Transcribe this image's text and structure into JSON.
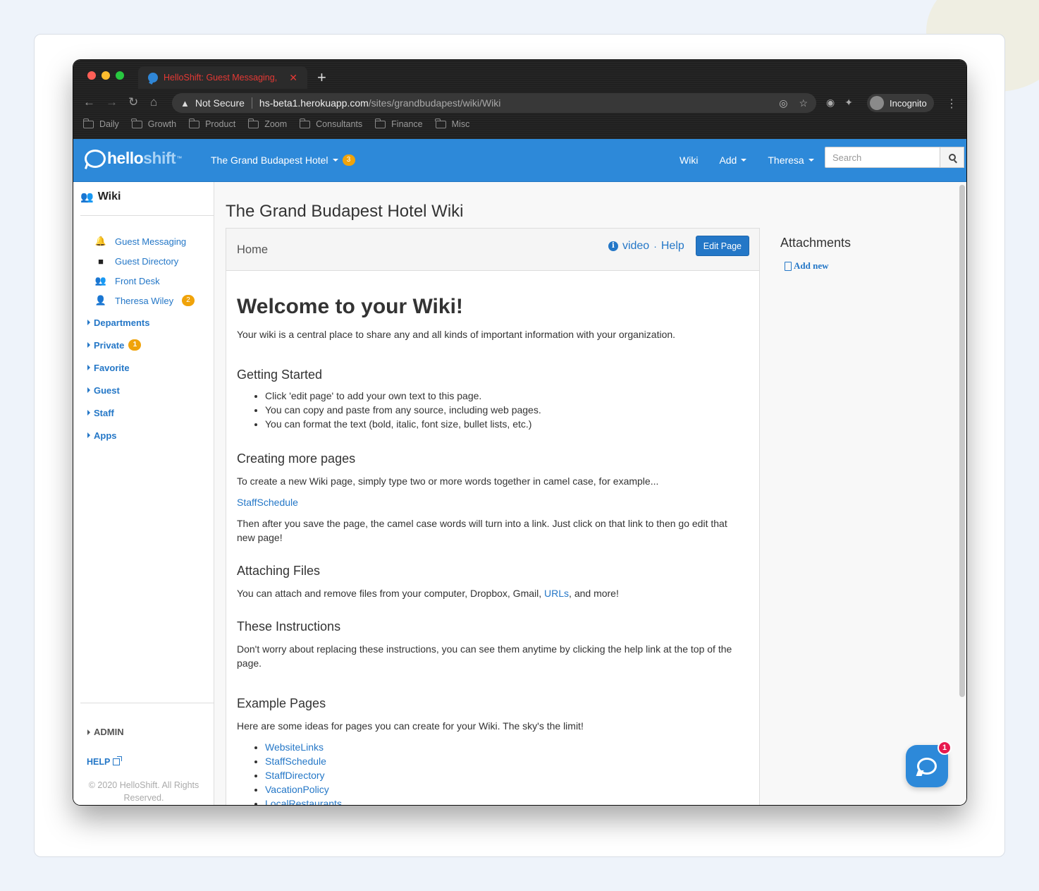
{
  "browser": {
    "tab_title": "HelloShift: Guest Messaging,",
    "tab_close": "✕",
    "new_tab": "+",
    "not_secure": "Not Secure",
    "url_host": "hs-beta1.herokuapp.com",
    "url_path": "/sites/grandbudapest/wiki/Wiki",
    "profile_label": "Incognito",
    "bookmarks": [
      "Daily",
      "Growth",
      "Product",
      "Zoom",
      "Consultants",
      "Finance",
      "Misc"
    ]
  },
  "header": {
    "logo_hello": "hello",
    "logo_shift": "shift",
    "logo_tm": "™",
    "hotel_name": "The Grand Budapest Hotel",
    "hotel_badge": "3",
    "nav": {
      "wiki": "Wiki",
      "add": "Add",
      "user": "Theresa"
    },
    "search_placeholder": "Search"
  },
  "sidebar": {
    "title": "Wiki",
    "links": [
      {
        "label": "Guest Messaging",
        "icon": "bell-icon"
      },
      {
        "label": "Guest Directory",
        "icon": "folder-icon"
      },
      {
        "label": "Front Desk",
        "icon": "users-icon"
      },
      {
        "label": "Theresa Wiley",
        "icon": "user-icon",
        "badge": "2"
      }
    ],
    "groups": [
      {
        "label": "Departments"
      },
      {
        "label": "Private",
        "badge": "1"
      },
      {
        "label": "Favorite"
      },
      {
        "label": "Guest"
      },
      {
        "label": "Staff"
      },
      {
        "label": "Apps"
      }
    ],
    "admin": "ADMIN",
    "help": "HELP",
    "copyright": "© 2020 HelloShift. All Rights Reserved."
  },
  "main": {
    "page_title": "The Grand Budapest Hotel Wiki",
    "breadcrumb": "Home",
    "video_link": "video",
    "dot": "·",
    "help_link": "Help",
    "edit_button": "Edit Page",
    "attachments_title": "Attachments",
    "add_new": "Add new"
  },
  "content": {
    "h1": "Welcome to your Wiki!",
    "intro": "Your wiki is a central place to share any and all kinds of important information with your organization.",
    "getting_started": {
      "heading": "Getting Started",
      "items": [
        "Click 'edit page' to add your own text to this page.",
        "You can copy and paste from any source, including web pages.",
        "You can format the text (bold, italic, font size, bullet lists, etc.)"
      ]
    },
    "creating": {
      "heading": "Creating more pages",
      "p1": "To create a new Wiki page, simply type two or more words together in camel case, for example...",
      "example_link": "StaffSchedule",
      "p2": "Then after you save the page, the camel case words will turn into a link. Just click on that link to then go edit that new page!"
    },
    "attaching": {
      "heading": "Attaching Files",
      "p_before": "You can attach and remove files from your computer, Dropbox, Gmail, ",
      "link": "URLs",
      "p_after": ", and more!"
    },
    "instructions": {
      "heading": "These Instructions",
      "p": "Don't worry about replacing these instructions, you can see them anytime by clicking the help link at the top of the page."
    },
    "examples": {
      "heading": "Example Pages",
      "p": "Here are some ideas for pages you can create for your Wiki. The sky's the limit!",
      "links": [
        "WebsiteLinks",
        "StaffSchedule",
        "StaffDirectory",
        "VacationPolicy",
        "LocalRestaurants"
      ]
    }
  },
  "chat": {
    "badge": "1"
  },
  "colors": {
    "brand_blue": "#2d89d9",
    "link_blue": "#2477c7",
    "badge_orange": "#f0a30a",
    "chat_badge": "#e8194e"
  }
}
